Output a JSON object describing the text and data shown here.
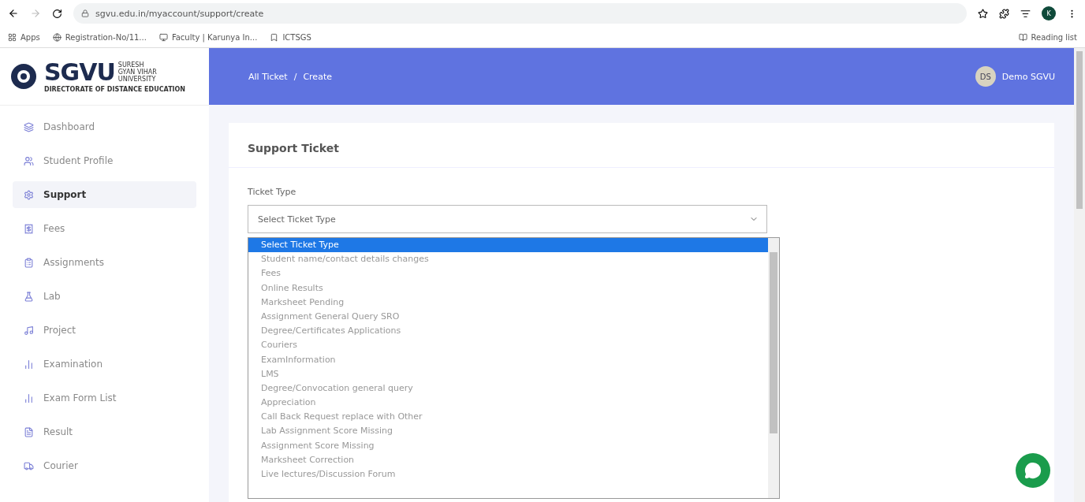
{
  "browser": {
    "url": "sgvu.edu.in/myaccount/support/create",
    "bookmarks": [
      "Apps",
      "Registration-No/11...",
      "Faculty | Karunya In...",
      "ICTSGS"
    ],
    "reading_list": "Reading list",
    "profile_initial": "K"
  },
  "logo": {
    "name": "SGVU",
    "tagline": [
      "SURESH",
      "GYAN VIHAR",
      "UNIVERSITY"
    ],
    "subtitle": "DIRECTORATE OF DISTANCE EDUCATION"
  },
  "header": {
    "breadcrumb": [
      "All Ticket",
      "Create"
    ],
    "separator": "/",
    "user_initials": "DS",
    "user_name": "Demo SGVU"
  },
  "sidebar": {
    "items": [
      {
        "label": "Dashboard",
        "selected": false
      },
      {
        "label": "Student Profile",
        "selected": false
      },
      {
        "label": "Support",
        "selected": true
      },
      {
        "label": "Fees",
        "selected": false
      },
      {
        "label": "Assignments",
        "selected": false
      },
      {
        "label": "Lab",
        "selected": false
      },
      {
        "label": "Project",
        "selected": false
      },
      {
        "label": "Examination",
        "selected": false
      },
      {
        "label": "Exam Form List",
        "selected": false
      },
      {
        "label": "Result",
        "selected": false
      },
      {
        "label": "Courier",
        "selected": false
      }
    ]
  },
  "card": {
    "title": "Support Ticket",
    "field_label": "Ticket Type",
    "select_value": "Select Ticket Type",
    "options": [
      {
        "label": "Select Ticket Type",
        "selected": true
      },
      {
        "label": "Student name/contact details changes",
        "selected": false
      },
      {
        "label": "Fees",
        "selected": false
      },
      {
        "label": "Online Results",
        "selected": false
      },
      {
        "label": "Marksheet Pending",
        "selected": false
      },
      {
        "label": "Assignment General Query SRO",
        "selected": false
      },
      {
        "label": "Degree/Certificates Applications",
        "selected": false
      },
      {
        "label": "Couriers",
        "selected": false
      },
      {
        "label": "ExamInformation",
        "selected": false
      },
      {
        "label": "LMS",
        "selected": false
      },
      {
        "label": "Degree/Convocation general query",
        "selected": false
      },
      {
        "label": "Appreciation",
        "selected": false
      },
      {
        "label": "Call Back Request replace with Other",
        "selected": false
      },
      {
        "label": "Lab Assignment Score Missing",
        "selected": false
      },
      {
        "label": "Assignment Score Missing",
        "selected": false
      },
      {
        "label": "Marksheet Correction",
        "selected": false
      },
      {
        "label": "Live lectures/Discussion Forum",
        "selected": false
      }
    ]
  }
}
